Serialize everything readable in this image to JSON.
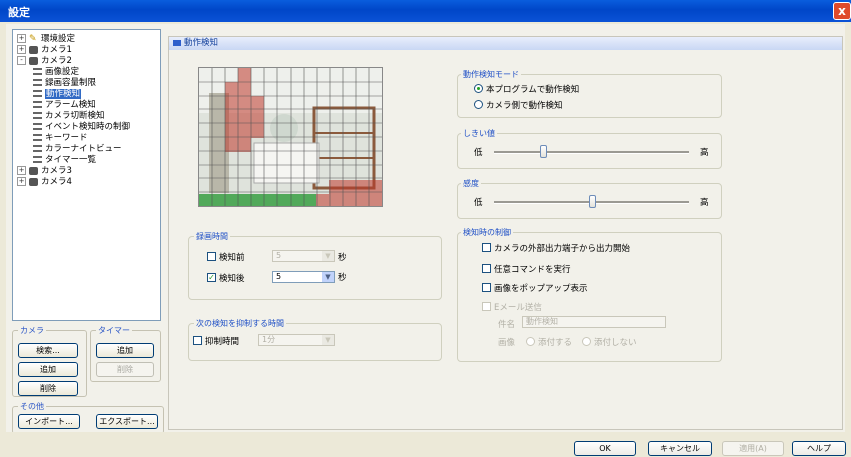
{
  "window": {
    "title": "設定",
    "close_glyph": "x"
  },
  "tree": {
    "items": [
      {
        "label": "環境設定",
        "level": 0,
        "expander": "+",
        "icon": "environment-icon"
      },
      {
        "label": "カメラ1",
        "level": 0,
        "expander": "+",
        "icon": "camera-icon"
      },
      {
        "label": "カメラ2",
        "level": 0,
        "expander": "-",
        "icon": "camera-icon"
      },
      {
        "label": "画像設定",
        "level": 1,
        "icon": "leaf-icon"
      },
      {
        "label": "録画容量制限",
        "level": 1,
        "icon": "leaf-icon"
      },
      {
        "label": "動作検知",
        "level": 1,
        "icon": "leaf-icon",
        "selected": true
      },
      {
        "label": "アラーム検知",
        "level": 1,
        "icon": "leaf-icon"
      },
      {
        "label": "カメラ切断検知",
        "level": 1,
        "icon": "leaf-icon"
      },
      {
        "label": "イベント検知時の制御",
        "level": 1,
        "icon": "leaf-icon"
      },
      {
        "label": "キーワード",
        "level": 1,
        "icon": "leaf-icon"
      },
      {
        "label": "カラーナイトビュー",
        "level": 1,
        "icon": "leaf-icon"
      },
      {
        "label": "タイマー一覧",
        "level": 1,
        "icon": "leaf-icon"
      },
      {
        "label": "カメラ3",
        "level": 0,
        "expander": "+",
        "icon": "camera-icon"
      },
      {
        "label": "カメラ4",
        "level": 0,
        "expander": "+",
        "icon": "camera-icon"
      }
    ]
  },
  "left_groups": {
    "camera": {
      "title": "カメラ",
      "search": "検索...",
      "add": "追加",
      "delete": "削除"
    },
    "timer": {
      "title": "タイマー",
      "add": "追加",
      "delete": "削除"
    },
    "other": {
      "title": "その他",
      "import": "インポート...",
      "export": "エクスポート..."
    }
  },
  "panel": {
    "title": "動作検知"
  },
  "recording_time": {
    "title": "録画時間",
    "before": {
      "label": "検知前",
      "value": "5",
      "unit": "秒",
      "checked": false
    },
    "after": {
      "label": "検知後",
      "value": "5",
      "unit": "秒",
      "checked": true
    }
  },
  "suppress": {
    "title": "次の検知を抑制する時間",
    "label": "抑制時間",
    "value": "1分"
  },
  "detection_mode": {
    "title": "動作検知モード",
    "options": [
      {
        "label": "本プログラムで動作検知",
        "selected": true
      },
      {
        "label": "カメラ側で動作検知",
        "selected": false
      }
    ]
  },
  "threshold": {
    "title": "しきい値",
    "low": "低",
    "high": "高",
    "value": 0.25
  },
  "sensitivity": {
    "title": "感度",
    "low": "低",
    "high": "高",
    "value": 0.5
  },
  "control": {
    "title": "検知時の制御",
    "items": [
      {
        "label": "カメラの外部出力端子から出力開始",
        "checked": false,
        "enabled": true
      },
      {
        "label": "任意コマンドを実行",
        "checked": false,
        "enabled": true
      },
      {
        "label": "画像をポップアップ表示",
        "checked": false,
        "enabled": true
      },
      {
        "label": "Eメール送信",
        "checked": false,
        "enabled": false
      }
    ],
    "subject_label": "件名",
    "subject_value": "動作検知",
    "image_label": "画像",
    "image_options": [
      "添付する",
      "添付しない"
    ]
  },
  "dialog": {
    "ok": "OK",
    "cancel": "キャンセル",
    "apply": "適用(A)",
    "help": "ヘルプ"
  },
  "colors": {
    "accent": "#316ac5",
    "title_bar": "#0046c8",
    "mask_red": "#c0392b",
    "mask_green": "#2e9a3a"
  },
  "preview_grid": {
    "cols": 14,
    "rows": 10
  }
}
